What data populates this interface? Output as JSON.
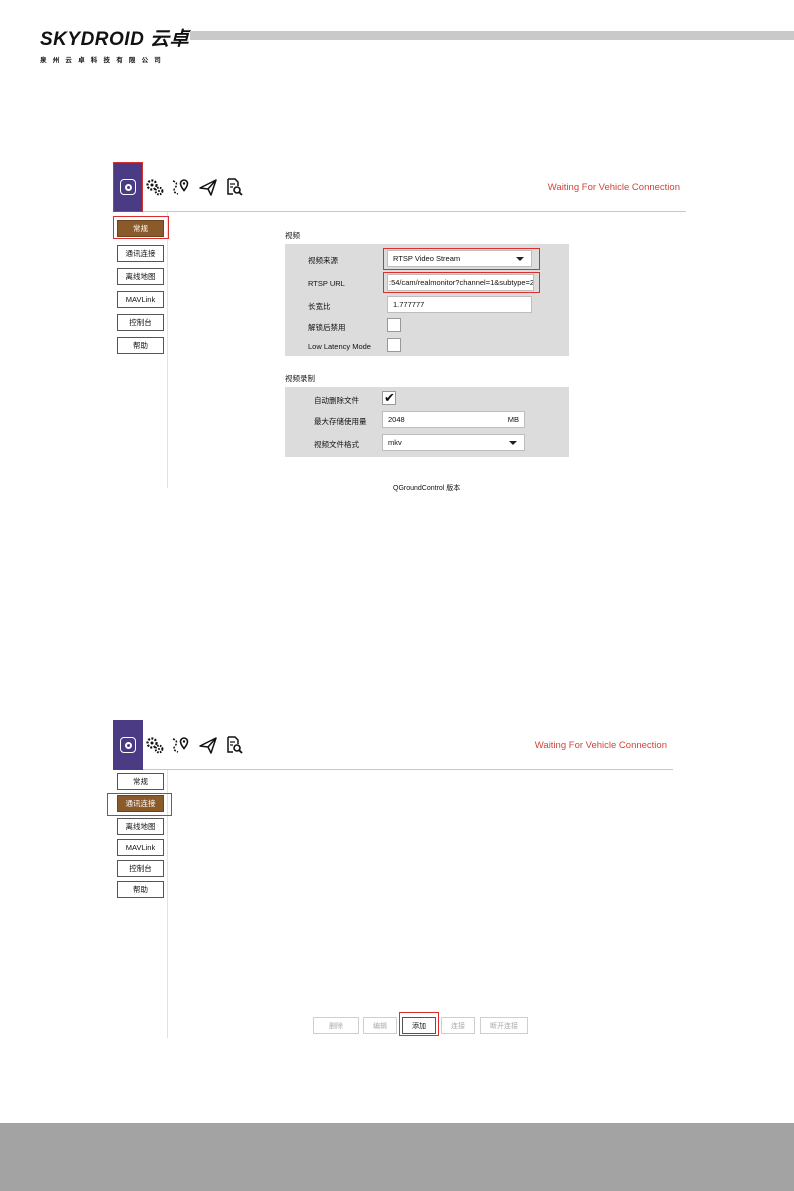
{
  "brand": {
    "logo_text": "SKYDROID 云卓",
    "subtitle": "泉州云卓科技有限公司"
  },
  "screen1": {
    "status": "Waiting For Vehicle Connection",
    "sidebar": [
      "常规",
      "通讯连接",
      "离线地图",
      "MAVLink",
      "控制台",
      "帮助"
    ],
    "video_section": {
      "title": "视频",
      "source_label": "视频来源",
      "source_value": "RTSP Video Stream",
      "url_label": "RTSP URL",
      "url_value": ":54/cam/realmonitor?channel=1&subtype=2",
      "aspect_label": "长宽比",
      "aspect_value": "1.777777",
      "disable_label": "解锁后禁用",
      "disable_checked": false,
      "low_latency_label": "Low Latency Mode",
      "low_latency_checked": false
    },
    "recording_section": {
      "title": "视频录制",
      "auto_delete_label": "自动删除文件",
      "auto_delete_checked": true,
      "max_storage_label": "最大存储使用量",
      "max_storage_value": "2048",
      "max_storage_unit": "MB",
      "format_label": "视频文件格式",
      "format_value": "mkv"
    },
    "version_label": "QGroundControl 版本"
  },
  "screen2": {
    "status": "Waiting For Vehicle Connection",
    "sidebar": [
      "常规",
      "通讯连接",
      "离线地图",
      "MAVLink",
      "控制台",
      "帮助"
    ],
    "buttons": [
      "删除",
      "编辑",
      "添加",
      "连接",
      "断开连接"
    ]
  },
  "colors": {
    "toolbar_home": "#4a3b84",
    "active_tab": "#8b5a2b",
    "status_text": "#d0453a",
    "highlight_box": "#d92f2f"
  }
}
